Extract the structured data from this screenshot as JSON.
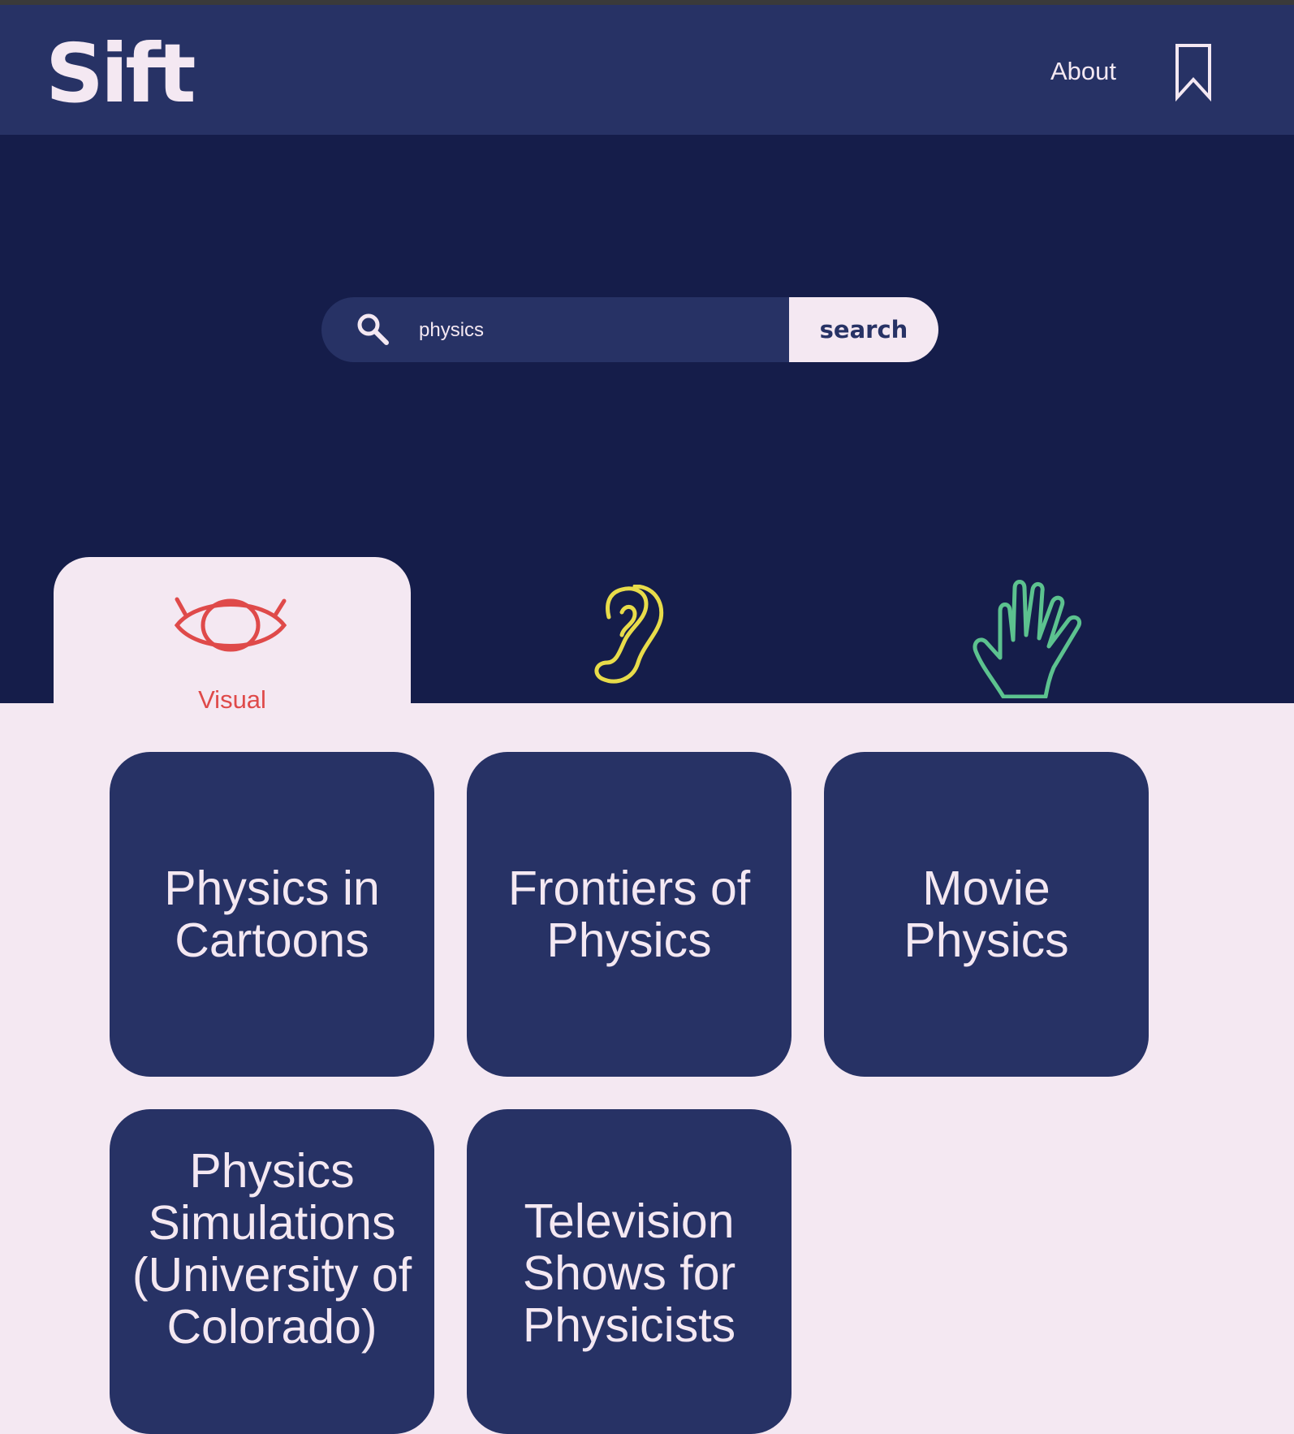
{
  "header": {
    "logo": "Sift",
    "about_label": "About",
    "bookmark_icon": "bookmark-icon"
  },
  "search": {
    "value": "physics",
    "button_label": "search",
    "icon": "search-icon"
  },
  "tabs": [
    {
      "label": "Visual",
      "icon": "eye-icon",
      "color": "#df4a4a",
      "active": true
    },
    {
      "label": "",
      "icon": "ear-icon",
      "color": "#e8dc4a",
      "active": false
    },
    {
      "label": "",
      "icon": "hand-icon",
      "color": "#5cc28f",
      "active": false
    }
  ],
  "results": [
    {
      "title": "Physics in Cartoons"
    },
    {
      "title": "Frontiers of Physics"
    },
    {
      "title": "Movie Physics"
    },
    {
      "title": "Physics Simulations (University of Colorado)"
    },
    {
      "title": "Television Shows for Physicists"
    }
  ],
  "colors": {
    "header_bg": "#273265",
    "hero_bg": "#151d4a",
    "page_bg": "#f4e8f2",
    "card_bg": "#273265",
    "text_light": "#f4e8f2"
  }
}
